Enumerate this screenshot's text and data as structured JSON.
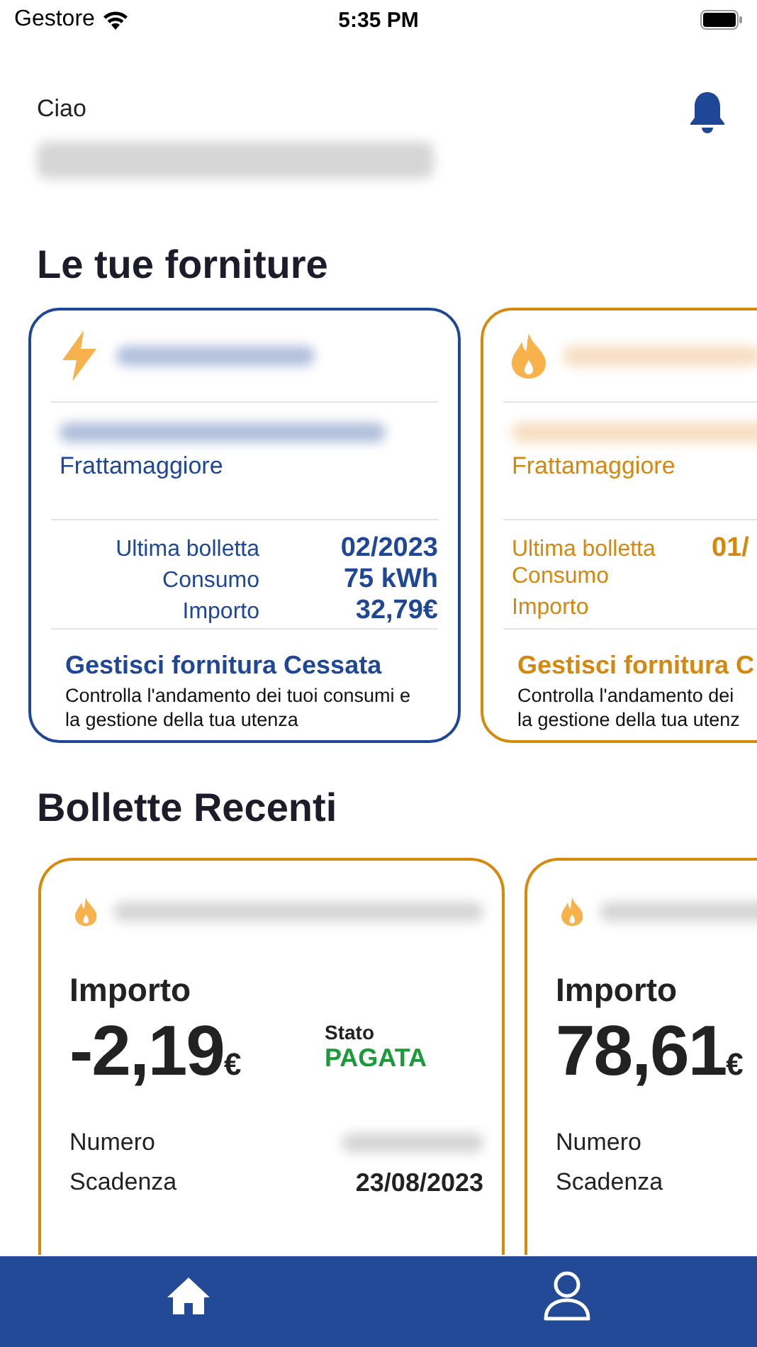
{
  "status_bar": {
    "carrier": "Gestore",
    "time": "5:35 PM"
  },
  "header": {
    "greeting": "Ciao"
  },
  "supplies_section": {
    "title": "Le tue forniture"
  },
  "supplies": [
    {
      "kind": "electricity",
      "city": "Frattamaggiore",
      "rows": [
        {
          "label": "Ultima bolletta",
          "value": "02/2023"
        },
        {
          "label": "Consumo",
          "value": "75 kWh"
        },
        {
          "label": "Importo",
          "value": "32,79€"
        }
      ],
      "action_title": "Gestisci fornitura Cessata",
      "description_lines": [
        "Controlla l'andamento dei tuoi consumi e",
        "la gestione della tua utenza"
      ]
    },
    {
      "kind": "gas",
      "city": "Frattamaggiore",
      "rows": [
        {
          "label": "Ultima bolletta",
          "value": "01/"
        },
        {
          "label": "Consumo"
        },
        {
          "label": "Importo"
        }
      ],
      "action_title": "Gestisci fornitura C",
      "description_lines": [
        "Controlla l'andamento dei",
        "la gestione della tua utenz"
      ]
    }
  ],
  "bills_section": {
    "title": "Bollette Recenti"
  },
  "bills": [
    {
      "kind": "gas",
      "amount_label": "Importo",
      "amount": "-2,19",
      "currency": "€",
      "status_label": "Stato",
      "status": "PAGATA",
      "rows": [
        {
          "label": "Numero",
          "blurred": true
        },
        {
          "label": "Scadenza",
          "value": "23/08/2023"
        }
      ]
    },
    {
      "kind": "gas",
      "amount_label": "Importo",
      "amount": "78,61",
      "currency": "€",
      "rows": [
        {
          "label": "Numero"
        },
        {
          "label": "Scadenza"
        }
      ]
    }
  ]
}
